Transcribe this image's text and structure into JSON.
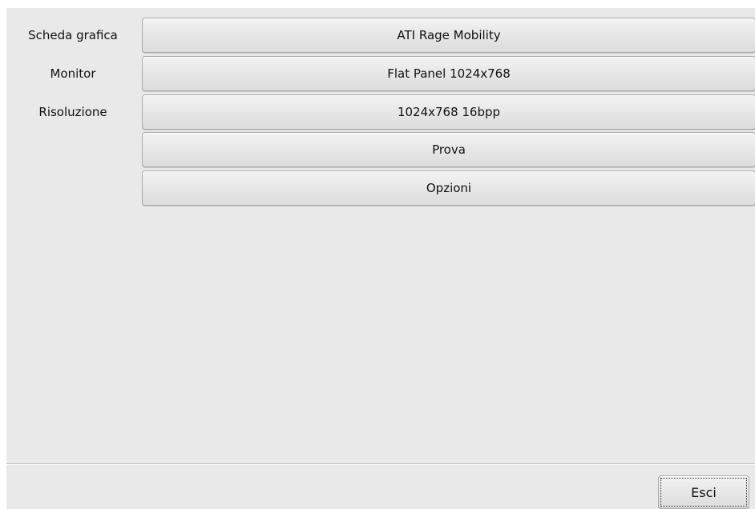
{
  "form": {
    "graphics_card": {
      "label": "Scheda grafica",
      "value": "ATI Rage Mobility"
    },
    "monitor": {
      "label": "Monitor",
      "value": "Flat Panel 1024x768"
    },
    "resolution": {
      "label": "Risoluzione",
      "value": "1024x768 16bpp"
    }
  },
  "actions": {
    "test_label": "Prova",
    "options_label": "Opzioni"
  },
  "footer": {
    "exit_label": "Esci"
  }
}
